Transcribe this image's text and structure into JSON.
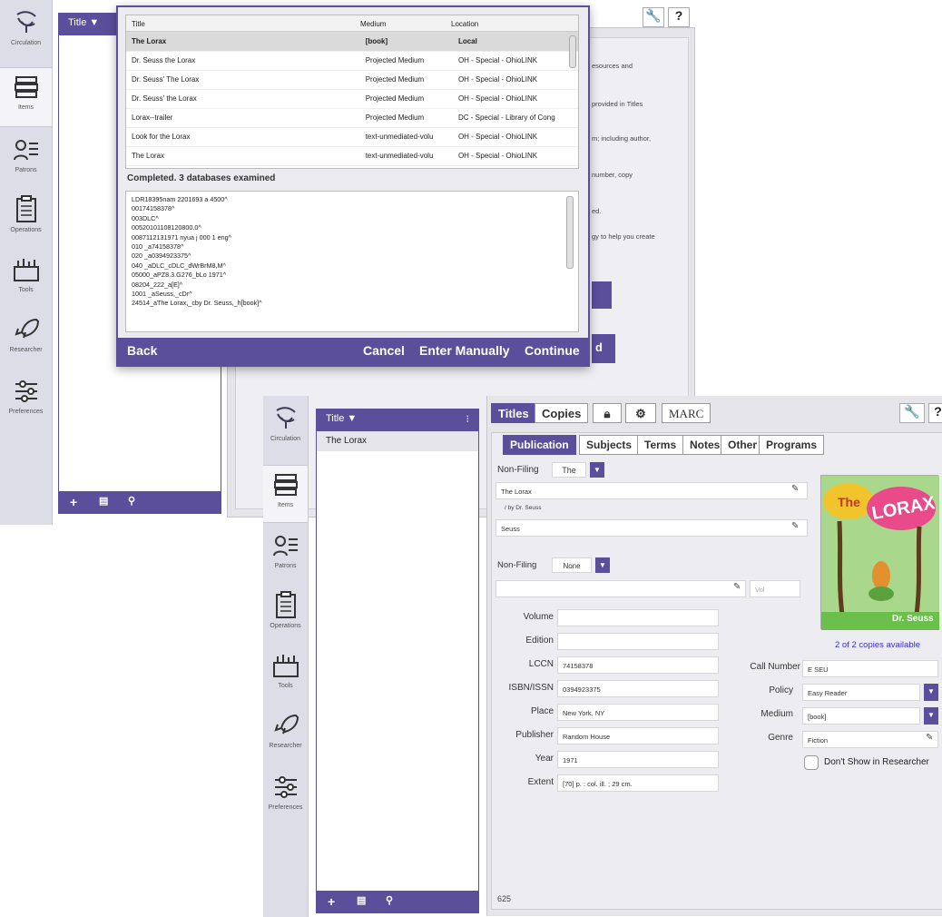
{
  "nav": [
    {
      "label": "Circulation",
      "icon": "circulation-icon"
    },
    {
      "label": "Items",
      "icon": "books-icon"
    },
    {
      "label": "Patrons",
      "icon": "patrons-icon"
    },
    {
      "label": "Operations",
      "icon": "clipboard-icon"
    },
    {
      "label": "Tools",
      "icon": "toolbox-icon"
    },
    {
      "label": "Researcher",
      "icon": "rocket-icon"
    },
    {
      "label": "Preferences",
      "icon": "sliders-icon"
    }
  ],
  "back_window": {
    "list_header": "Title ▼",
    "help_lines": [
      "esources and",
      "provided in Titles",
      "m; including author,",
      "number, copy",
      "ed.",
      "gy to help you create"
    ],
    "hidden_button_fragment": "d"
  },
  "dialog": {
    "columns": [
      "Title",
      "Medium",
      "Location"
    ],
    "rows": [
      {
        "title": "The Lorax",
        "medium": "[book]",
        "location": "Local"
      },
      {
        "title": "Dr. Seuss the Lorax",
        "medium": "Projected Medium",
        "location": "OH - Special - OhioLINK"
      },
      {
        "title": "Dr. Seuss' The Lorax",
        "medium": "Projected Medium",
        "location": "OH - Special - OhioLINK"
      },
      {
        "title": "Dr. Seuss' the Lorax",
        "medium": "Projected Medium",
        "location": "OH - Special - OhioLINK"
      },
      {
        "title": "Lorax--trailer",
        "medium": "Projected Medium",
        "location": "DC - Special - Library of Cong"
      },
      {
        "title": "Look for the Lorax",
        "medium": "text-unmediated-volu",
        "location": "OH - Special - OhioLINK"
      },
      {
        "title": "The Lorax",
        "medium": "text-unmediated-volu",
        "location": "OH - Special - OhioLINK"
      }
    ],
    "status": "Completed. 3 databases examined",
    "marc_lines": [
      "LDR18395nam 2201693 a 4500^",
      "00174158378^",
      "003DLC^",
      "00520101108120800.0^",
      "0087112131971 nyua j 000 1 eng^",
      "010 _a74158378^",
      "020 _a0394923375^",
      "040 _aDLC_cDLC_dWrBrM8,M^",
      "05000_aPZ8.3.G276_bLo 1971^",
      "08204_222_a[E]^",
      "1001 _aSeuss,_cDr^",
      "24514_aThe Lorax,_cby Dr. Seuss,_h[book]^"
    ],
    "back": "Back",
    "cancel": "Cancel",
    "enter_manually": "Enter Manually",
    "continue": "Continue"
  },
  "front_window": {
    "list_header": "Title ▼",
    "list_items": [
      "The Lorax"
    ],
    "top_tabs": {
      "titles": "Titles",
      "copies": "Copies",
      "marc": "MARC"
    },
    "sub_tabs": [
      "Publication",
      "Subjects",
      "Terms",
      "Notes",
      "Other",
      "Programs"
    ],
    "nonfiling_label": "Non-Filing",
    "nonfiling_value": "The",
    "title_value": "The Lorax",
    "responsibility": "/ by Dr. Seuss",
    "author_value": "Seuss",
    "nonfiling2_value": "None",
    "vol_placeholder": "Vol",
    "fields": [
      {
        "label": "Volume",
        "value": ""
      },
      {
        "label": "Edition",
        "value": ""
      },
      {
        "label": "LCCN",
        "value": "74158378"
      },
      {
        "label": "ISBN/ISSN",
        "value": "0394923375"
      },
      {
        "label": "Place",
        "value": "New York, NY"
      },
      {
        "label": "Publisher",
        "value": "Random House"
      },
      {
        "label": "Year",
        "value": "1971"
      },
      {
        "label": "Extent",
        "value": "[70] p. : col. ill. ; 29 cm."
      }
    ],
    "cover_title": "The LORAX",
    "cover_author": "Dr. Seuss",
    "copies_available": "2 of 2 copies available",
    "call_number_label": "Call Number",
    "call_number": "E SEU",
    "policy_label": "Policy",
    "policy": "Easy Reader",
    "medium_label": "Medium",
    "medium": "[book]",
    "genre_label": "Genre",
    "genre": "Fiction",
    "dont_show": "Don't Show in Researcher",
    "record_count": "625"
  },
  "colors": {
    "accent": "#5b4f9c",
    "sidebar": "#dcdde6",
    "panel": "#e6e6ea"
  }
}
